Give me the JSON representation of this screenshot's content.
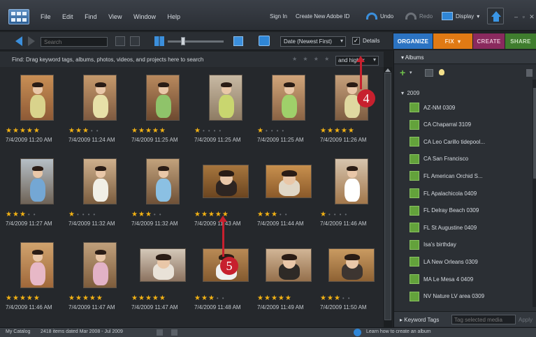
{
  "menubar": {
    "items": [
      "File",
      "Edit",
      "Find",
      "View",
      "Window",
      "Help"
    ],
    "sign_in": "Sign In",
    "create_id": "Create New Adobe ID",
    "undo": "Undo",
    "redo": "Redo",
    "display": "Display",
    "window_controls": "– ▫ ✕"
  },
  "toolbar": {
    "search_placeholder": "Search",
    "sort": "Date (Newest First)",
    "details_label": "Details",
    "details_checked": "✓"
  },
  "tabs": [
    "ORGANIZE",
    "FIX",
    "CREATE",
    "SHARE"
  ],
  "find_bar": {
    "text": "Find: Drag keyword tags, albums, photos, videos, and projects here to search",
    "stars": "★ ★ ★ ★ ★",
    "condition": "and higher"
  },
  "photos": [
    {
      "rating": 5,
      "date": "7/4/2009 11:20 AM"
    },
    {
      "rating": 3,
      "date": "7/4/2009 11:24 AM"
    },
    {
      "rating": 5,
      "date": "7/4/2009 11:25 AM"
    },
    {
      "rating": 1,
      "date": "7/4/2009 11:25 AM"
    },
    {
      "rating": 1,
      "date": "7/4/2009 11:25 AM"
    },
    {
      "rating": 5,
      "date": "7/4/2009 11:26 AM"
    },
    {
      "rating": 3,
      "date": "7/4/2009 11:27 AM"
    },
    {
      "rating": 1,
      "date": "7/4/2009 11:32 AM"
    },
    {
      "rating": 3,
      "date": "7/4/2009 11:32 AM"
    },
    {
      "rating": 5,
      "date": "7/4/2009 11:43 AM"
    },
    {
      "rating": 3,
      "date": "7/4/2009 11:44 AM"
    },
    {
      "rating": 1,
      "date": "7/4/2009 11:46 AM"
    },
    {
      "rating": 5,
      "date": "7/4/2009 11:46 AM"
    },
    {
      "rating": 5,
      "date": "7/4/2009 11:47 AM"
    },
    {
      "rating": 5,
      "date": "7/4/2009 11:47 AM"
    },
    {
      "rating": 3,
      "date": "7/4/2009 11:48 AM"
    },
    {
      "rating": 5,
      "date": "7/4/2009 11:49 AM"
    },
    {
      "rating": 3,
      "date": "7/4/2009 11:50 AM"
    }
  ],
  "callouts": {
    "four": "4",
    "five": "5"
  },
  "albums_panel": {
    "title": "Albums",
    "year": "2009",
    "albums": [
      "AZ-NM 0309",
      "CA Chaparral 3109",
      "CA Leo Carillo tidepool...",
      "CA San Francisco",
      "FL American Orchid S...",
      "FL Apalachicola 0409",
      "FL Delray Beach 0309",
      "FL St Augustine 0409",
      "Isa's birthday",
      "LA New Orleans 0309",
      "MA Le Mesa 4 0409",
      "NV Nature LV area 0309"
    ],
    "keyword_tags": "Keyword Tags",
    "tag_placeholder": "Tag selected media",
    "apply": "Apply"
  },
  "status": {
    "catalog": "My Catalog",
    "count": "2418 items dated Mar 2008 - Jul 2009",
    "learn": "Learn how to create an album"
  }
}
